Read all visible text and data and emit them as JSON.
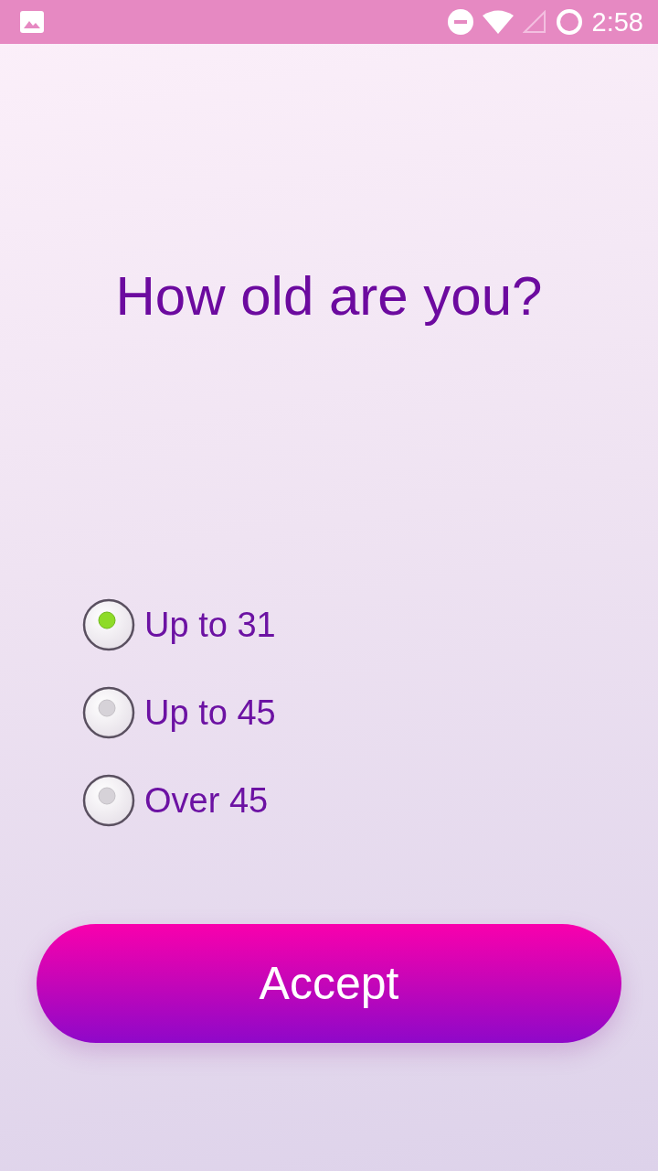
{
  "status_bar": {
    "time": "2:58"
  },
  "question": "How old are you?",
  "options": [
    {
      "label": "Up to 31",
      "selected": true
    },
    {
      "label": "Up to 45",
      "selected": false
    },
    {
      "label": "Over 45",
      "selected": false
    }
  ],
  "accept_button": {
    "label": "Accept"
  }
}
